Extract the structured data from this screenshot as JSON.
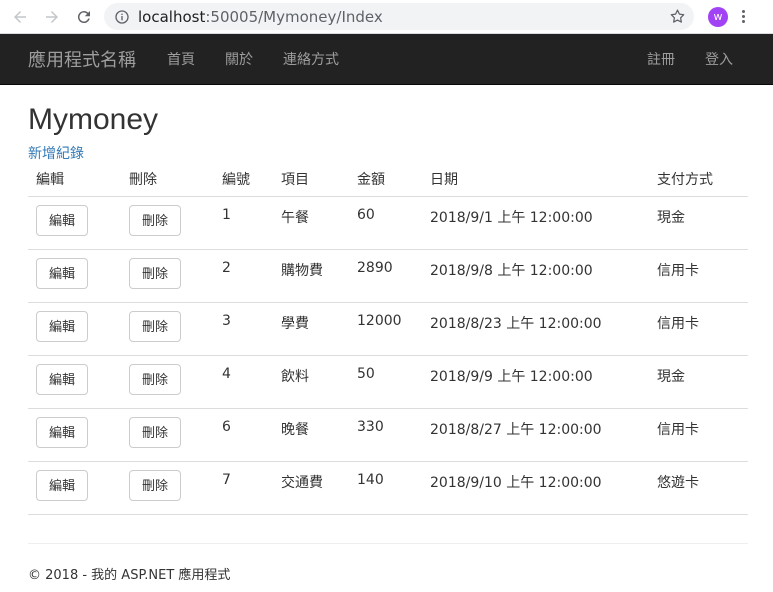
{
  "browser": {
    "url_host": "localhost",
    "url_rest": ":50005/Mymoney/Index",
    "profile_initial": "w"
  },
  "navbar": {
    "brand": "應用程式名稱",
    "links": [
      "首頁",
      "關於",
      "連絡方式"
    ],
    "right": [
      "註冊",
      "登入"
    ]
  },
  "page": {
    "title": "Mymoney",
    "create_link": "新增紀錄"
  },
  "table": {
    "headers": [
      "編輯",
      "刪除",
      "編號",
      "項目",
      "金額",
      "日期",
      "支付方式"
    ],
    "edit_label": "編輯",
    "delete_label": "刪除",
    "rows": [
      {
        "id": "1",
        "item": "午餐",
        "amount": "60",
        "date": "2018/9/1 上午 12:00:00",
        "payment": "現金"
      },
      {
        "id": "2",
        "item": "購物費",
        "amount": "2890",
        "date": "2018/9/8 上午 12:00:00",
        "payment": "信用卡"
      },
      {
        "id": "3",
        "item": "學費",
        "amount": "12000",
        "date": "2018/8/23 上午 12:00:00",
        "payment": "信用卡"
      },
      {
        "id": "4",
        "item": "飲料",
        "amount": "50",
        "date": "2018/9/9 上午 12:00:00",
        "payment": "現金"
      },
      {
        "id": "6",
        "item": "晚餐",
        "amount": "330",
        "date": "2018/8/27 上午 12:00:00",
        "payment": "信用卡"
      },
      {
        "id": "7",
        "item": "交通費",
        "amount": "140",
        "date": "2018/9/10 上午 12:00:00",
        "payment": "悠遊卡"
      }
    ]
  },
  "footer": {
    "text": "© 2018 - 我的 ASP.NET 應用程式"
  }
}
